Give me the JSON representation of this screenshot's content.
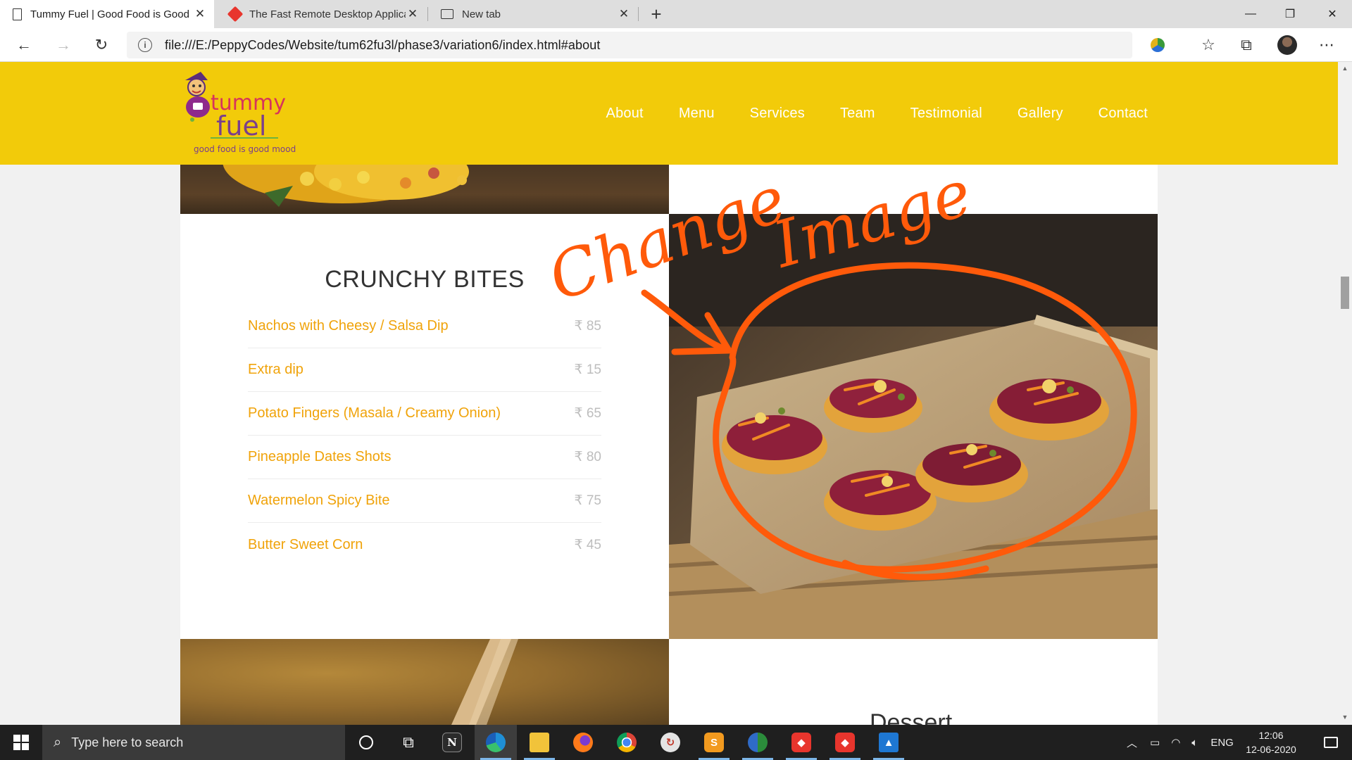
{
  "browser": {
    "tabs": [
      {
        "title": "Tummy Fuel | Good Food is Good Mood",
        "active": true
      },
      {
        "title": "The Fast Remote Desktop Application",
        "active": false
      },
      {
        "title": "New tab",
        "active": false
      }
    ],
    "url": "file:///E:/PeppyCodes/Website/tum62fu3l/phase3/variation6/index.html#about"
  },
  "site": {
    "logo": {
      "line1": "tummy",
      "line2": "fuel",
      "tagline": "good food is good mood"
    },
    "nav": [
      "About",
      "Menu",
      "Services",
      "Team",
      "Testimonial",
      "Gallery",
      "Contact"
    ]
  },
  "menu": {
    "title": "CRUNCHY BITES",
    "items": [
      {
        "name": "Nachos with Cheesy / Salsa Dip",
        "price": "₹ 85"
      },
      {
        "name": "Extra dip",
        "price": "₹ 15"
      },
      {
        "name": "Potato Fingers (Masala / Creamy Onion)",
        "price": "₹ 65"
      },
      {
        "name": "Pineapple Dates Shots",
        "price": "₹ 80"
      },
      {
        "name": "Watermelon Spicy Bite",
        "price": "₹ 75"
      },
      {
        "name": "Butter Sweet Corn",
        "price": "₹ 45"
      }
    ],
    "next_section_title": "Dessert"
  },
  "annotation": {
    "word1": "Change",
    "word2": "Image",
    "color": "#ff5a0a"
  },
  "colors": {
    "header": "#f2cb0a",
    "item_name": "#f0a30a",
    "price": "#bdbdbd"
  },
  "taskbar": {
    "search_placeholder": "Type here to search",
    "lang": "ENG",
    "time": "12:06",
    "date": "12-06-2020"
  }
}
